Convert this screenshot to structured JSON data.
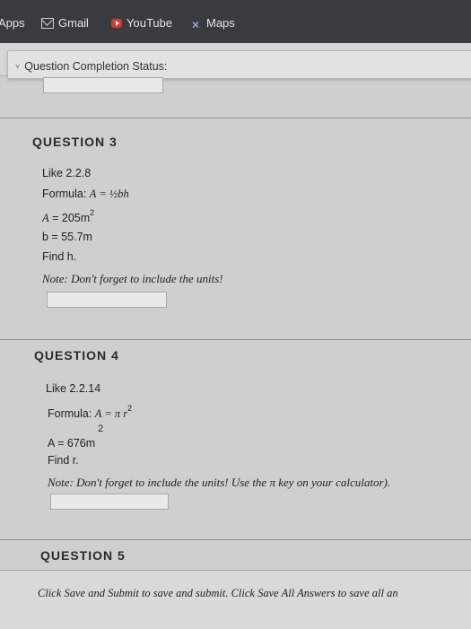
{
  "bookmarks": [
    {
      "label": "Apps",
      "icon": "apps-icon"
    },
    {
      "label": "Gmail",
      "icon": "gmail-icon"
    },
    {
      "label": "YouTube",
      "icon": "youtube-icon"
    },
    {
      "label": "Maps",
      "icon": "maps-icon"
    }
  ],
  "status": {
    "label": "Question Completion Status:",
    "chevron": "˅"
  },
  "questions": {
    "q3": {
      "title": "QUESTION 3",
      "like": "Like 2.2.8",
      "formula_label": "Formula: ",
      "formula_expr": "A = ½bh",
      "a_label": "A",
      "a_value": " = 205m",
      "a_sup": "2",
      "b_line": "b = 55.7m",
      "find": "Find h.",
      "note": "Note: Don't forget to include the units!"
    },
    "q4": {
      "title": "QUESTION 4",
      "like": "Like 2.2.14",
      "formula_label": "Formula: ",
      "formula_expr": "A = π r",
      "formula_sup": "2",
      "exp_above": "2",
      "a_line": "A = 676m",
      "find": "Find r.",
      "note": "Note: Don't forget to include the units! Use the π key on your calculator)."
    },
    "q5": {
      "title": "QUESTION 5"
    }
  },
  "footer_instruction": "Click Save and Submit to save and submit. Click Save All Answers to save all an"
}
